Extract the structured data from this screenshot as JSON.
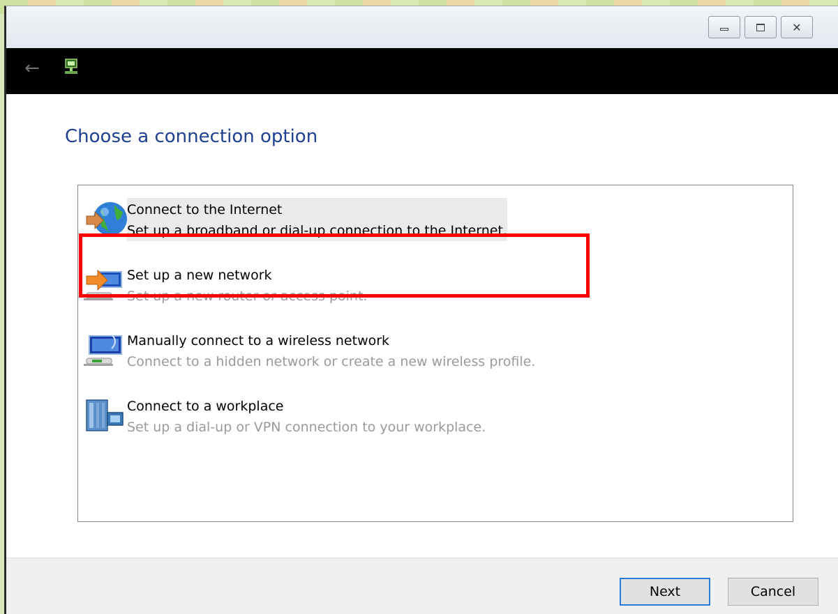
{
  "window": {
    "controls": {
      "minimize": "minimize",
      "maximize": "maximize",
      "close": "close"
    },
    "close_glyph": "✕"
  },
  "nav": {
    "back_icon": "back-arrow-icon",
    "back_glyph": "←"
  },
  "page": {
    "title": "Choose a connection option"
  },
  "options": [
    {
      "title": "Connect to the Internet",
      "description": "Set up a broadband or dial-up connection to the Internet.",
      "icon": "globe-icon",
      "selected": true
    },
    {
      "title": "Set up a new network",
      "description": "Set up a new router or access point.",
      "icon": "new-network-icon",
      "selected": false
    },
    {
      "title": "Manually connect to a wireless network",
      "description": "Connect to a hidden network or create a new wireless profile.",
      "icon": "wireless-network-icon",
      "selected": false,
      "annotated": true
    },
    {
      "title": "Connect to a workplace",
      "description": "Set up a dial-up or VPN connection to your workplace.",
      "icon": "workplace-icon",
      "selected": false
    }
  ],
  "footer": {
    "next_label": "Next",
    "cancel_label": "Cancel"
  },
  "colors": {
    "title_blue": "#1f3f8f",
    "highlight_red": "#ff0000",
    "focus_blue": "#2a7cd8"
  }
}
